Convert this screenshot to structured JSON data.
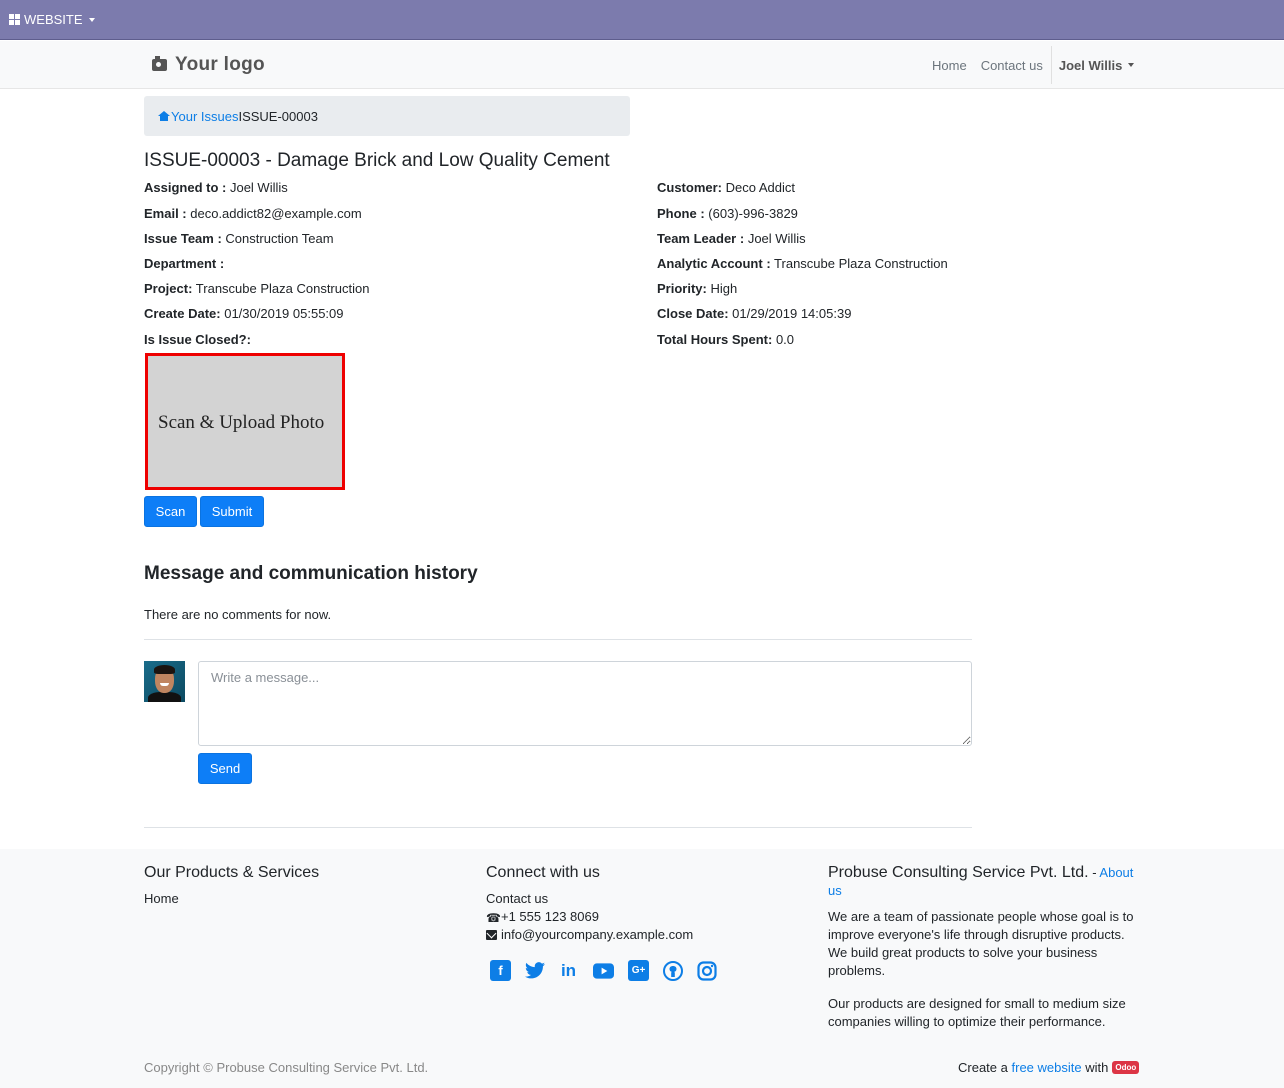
{
  "topbar": {
    "menu_label": "WEBSITE"
  },
  "navbar": {
    "logo_text": "Your logo",
    "links": [
      "Home",
      "Contact us"
    ],
    "user_name": "Joel Willis"
  },
  "breadcrumb": {
    "parent": "Your Issues",
    "current": "ISSUE-00003"
  },
  "issue": {
    "title": "ISSUE-00003 - Damage Brick and Low Quality Cement",
    "left": [
      {
        "label": "Assigned to :",
        "value": "Joel Willis"
      },
      {
        "label": "Email :",
        "value": "deco.addict82@example.com"
      },
      {
        "label": "Issue Team :",
        "value": "Construction Team"
      },
      {
        "label": "Department :",
        "value": ""
      },
      {
        "label": "Project:",
        "value": "Transcube Plaza Construction"
      },
      {
        "label": "Create Date:",
        "value": "01/30/2019 05:55:09"
      },
      {
        "label": "Is Issue Closed?:",
        "value": ""
      }
    ],
    "right": [
      {
        "label": "Customer:",
        "value": "Deco Addict"
      },
      {
        "label": "Phone :",
        "value": "(603)-996-3829"
      },
      {
        "label": "Team Leader :",
        "value": "Joel Willis"
      },
      {
        "label": "Analytic Account :",
        "value": "Transcube Plaza Construction"
      },
      {
        "label": "Priority:",
        "value": "High"
      },
      {
        "label": "Close Date:",
        "value": "01/29/2019 14:05:39"
      },
      {
        "label": "Total Hours Spent:",
        "value": "0.0"
      }
    ]
  },
  "scan": {
    "placeholder_text": "Scan & Upload Photo",
    "scan_label": "Scan",
    "submit_label": "Submit"
  },
  "messages": {
    "title": "Message and communication history",
    "empty_text": "There are no comments for now.",
    "input_placeholder": "Write a message...",
    "send_label": "Send"
  },
  "footer": {
    "products_title": "Our Products & Services",
    "products_link": "Home",
    "connect_title": "Connect with us",
    "contact_link": "Contact us",
    "phone": "+1 555 123 8069",
    "email": "info@yourcompany.example.com",
    "social_icons": [
      "facebook-icon",
      "twitter-icon",
      "linkedin-icon",
      "youtube-icon",
      "google-plus-icon",
      "github-icon",
      "instagram-icon"
    ],
    "company_title": "Probuse Consulting Service Pvt. Ltd.",
    "company_sep": " - ",
    "about_link": "About us",
    "about_p1": "We are a team of passionate people whose goal is to improve everyone's life through disruptive products. We build great products to solve your business problems.",
    "about_p2": "Our products are designed for small to medium size companies willing to optimize their performance.",
    "copyright": "Copyright © Probuse Consulting Service Pvt. Ltd.",
    "credit_prefix": "Create a",
    "credit_link": "free website",
    "credit_with": "with",
    "credit_badge": "Odoo"
  },
  "colors": {
    "topbar": "#7c7bad",
    "primary": "#0d7ef7",
    "link": "#0d7ee6",
    "scan_border": "#ee0000"
  }
}
